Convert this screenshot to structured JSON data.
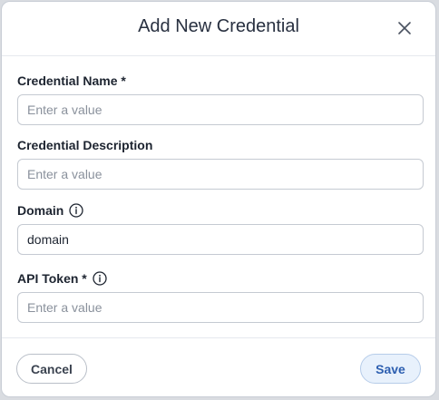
{
  "dialog": {
    "title": "Add New Credential"
  },
  "fields": [
    {
      "label": "Credential Name *",
      "value": "",
      "placeholder": "Enter a value"
    },
    {
      "label": "Credential Description",
      "value": "",
      "placeholder": "Enter a value"
    },
    {
      "label": "Domain",
      "value": "domain",
      "placeholder": ""
    },
    {
      "label": "API Token *",
      "value": "",
      "placeholder": "Enter a value"
    }
  ],
  "footer": {
    "cancel_label": "Cancel",
    "save_label": "Save"
  },
  "icons": {
    "close": "close-icon",
    "info": "info-icon"
  }
}
